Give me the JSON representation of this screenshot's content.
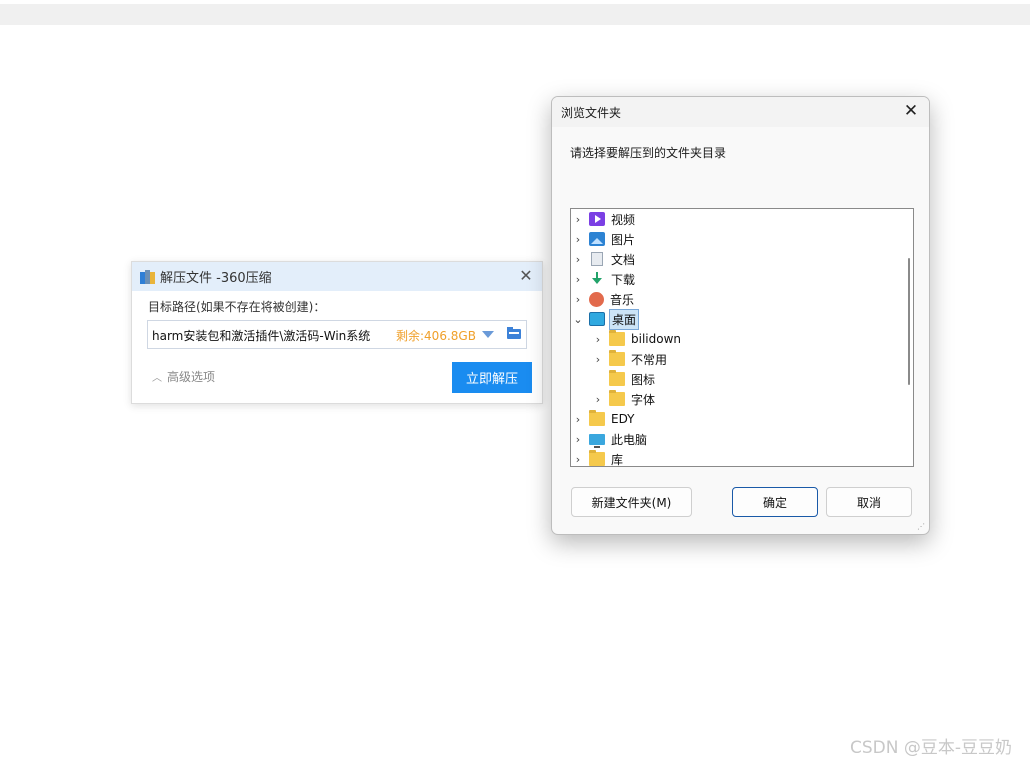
{
  "extract_dialog": {
    "title": "解压文件 -360压缩",
    "path_label": "目标路径(如果不存在将被创建)：",
    "path_value": "harm安装包和激活插件\\激活码-Win系统",
    "free_space": "剩余:406.8GB",
    "advanced_label": "高级选项",
    "extract_button": "立即解压",
    "close_glyph": "✕"
  },
  "browse_dialog": {
    "title": "浏览文件夹",
    "close_glyph": "✕",
    "instruction": "请选择要解压到的文件夹目录",
    "tree": [
      {
        "label": "视频",
        "icon": "video-icon",
        "expander": "›"
      },
      {
        "label": "图片",
        "icon": "pictures-icon",
        "expander": "›"
      },
      {
        "label": "文档",
        "icon": "documents-icon",
        "expander": "›"
      },
      {
        "label": "下载",
        "icon": "download-icon",
        "expander": "›"
      },
      {
        "label": "音乐",
        "icon": "music-icon",
        "expander": "›"
      },
      {
        "label": "桌面",
        "icon": "desktop-icon",
        "expander": "⌄",
        "selected": true
      },
      {
        "label": "bilidown",
        "icon": "folder-icon",
        "expander": "›"
      },
      {
        "label": "不常用",
        "icon": "folder-icon",
        "expander": "›"
      },
      {
        "label": "图标",
        "icon": "folder-icon",
        "expander": ""
      },
      {
        "label": "字体",
        "icon": "folder-icon",
        "expander": "›"
      },
      {
        "label": "EDY",
        "icon": "folder-icon",
        "expander": "›"
      },
      {
        "label": "此电脑",
        "icon": "computer-icon",
        "expander": "›"
      },
      {
        "label": "库",
        "icon": "folder-icon",
        "expander": "›"
      }
    ],
    "new_folder_button": "新建文件夹(M)",
    "ok_button": "确定",
    "cancel_button": "取消"
  },
  "watermark": "CSDN @豆本-豆豆奶",
  "colors": {
    "accent": "#1a8cf0",
    "free_space": "#f0a02a",
    "title_bar": "#e3eefa"
  }
}
